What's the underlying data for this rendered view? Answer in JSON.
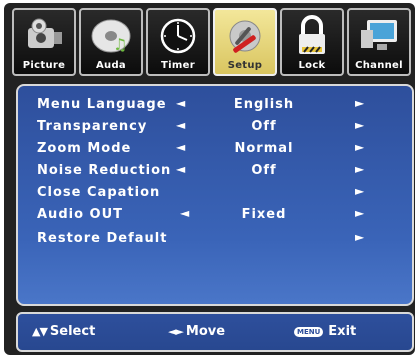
{
  "tabs": [
    {
      "label": "Picture",
      "icon": "camera-icon"
    },
    {
      "label": "Auda",
      "icon": "disc-icon"
    },
    {
      "label": "Timer",
      "icon": "clock-icon"
    },
    {
      "label": "Setup",
      "icon": "gear-tools-icon"
    },
    {
      "label": "Lock",
      "icon": "lock-icon"
    },
    {
      "label": "Channel",
      "icon": "monitor-icon"
    }
  ],
  "active_tab": "Setup",
  "menu": {
    "items": [
      {
        "label": "Menu Language",
        "value": "English",
        "left_arrow": "◄",
        "right_arrow": "►"
      },
      {
        "label": "Transparency",
        "value": "Off",
        "left_arrow": "◄",
        "right_arrow": "►"
      },
      {
        "label": "Zoom Mode",
        "value": "Normal",
        "left_arrow": "◄",
        "right_arrow": "►"
      },
      {
        "label": "Noise Reduction",
        "value": "Off",
        "left_arrow": "◄",
        "right_arrow": "►"
      },
      {
        "label": "Close Capation",
        "value": "",
        "left_arrow": "",
        "right_arrow": "►"
      },
      {
        "label": "Audio OUT",
        "value": "Fixed",
        "left_arrow": "◄",
        "right_arrow": "►"
      },
      {
        "label": "Restore Default",
        "value": "",
        "left_arrow": "",
        "right_arrow": "►"
      }
    ]
  },
  "footer": {
    "select_label": "Select",
    "move_label": "Move",
    "menu_key": "MENU",
    "exit_label": "Exit"
  },
  "colors": {
    "panel_blue": "#3a64b8",
    "active_tab": "#e6d77a"
  }
}
